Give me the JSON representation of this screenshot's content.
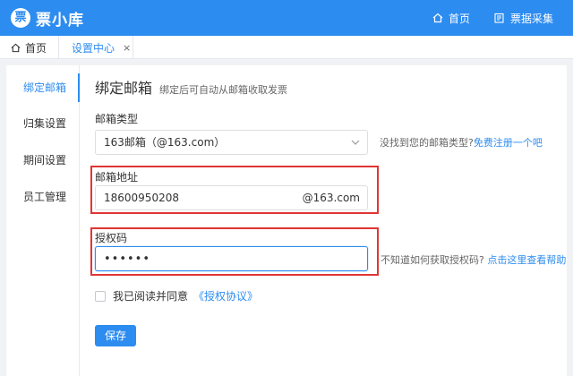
{
  "app": {
    "logo_glyph": "票",
    "name": "票小库",
    "brand_color": "#2d8cf0"
  },
  "topnav": {
    "home_label": "首页",
    "home_icon": "home-icon",
    "invoice_collect_label": "票据采集",
    "invoice_collect_icon": "edit-icon"
  },
  "tabs": {
    "home_label": "首页",
    "settings_label": "设置中心",
    "close_glyph": "×"
  },
  "sidebar": {
    "items": [
      {
        "label": "绑定邮箱",
        "active": true
      },
      {
        "label": "归集设置",
        "active": false
      },
      {
        "label": "期间设置",
        "active": false
      },
      {
        "label": "员工管理",
        "active": false
      }
    ]
  },
  "page": {
    "title": "绑定邮箱",
    "subtitle": "绑定后可自动从邮箱收取发票"
  },
  "form": {
    "mailbox_type_label": "邮箱类型",
    "mailbox_type_value": "163邮箱（@163.com）",
    "mailbox_type_hint": "没找到您的邮箱类型?",
    "mailbox_type_hint_link": "免费注册一个吧",
    "email_label": "邮箱地址",
    "email_value": "18600950208",
    "email_suffix": "@163.com",
    "auth_code_label": "授权码",
    "auth_code_value": "••••••",
    "auth_code_hint": "不知道如何获取授权码?",
    "auth_code_hint_link": "点击这里查看帮助",
    "agree_label": "我已阅读并同意",
    "agree_link": "《授权协议》",
    "agree_checked": false,
    "save_label": "保存"
  },
  "colors": {
    "highlight": "#e03535",
    "link": "#2d8cf0"
  }
}
